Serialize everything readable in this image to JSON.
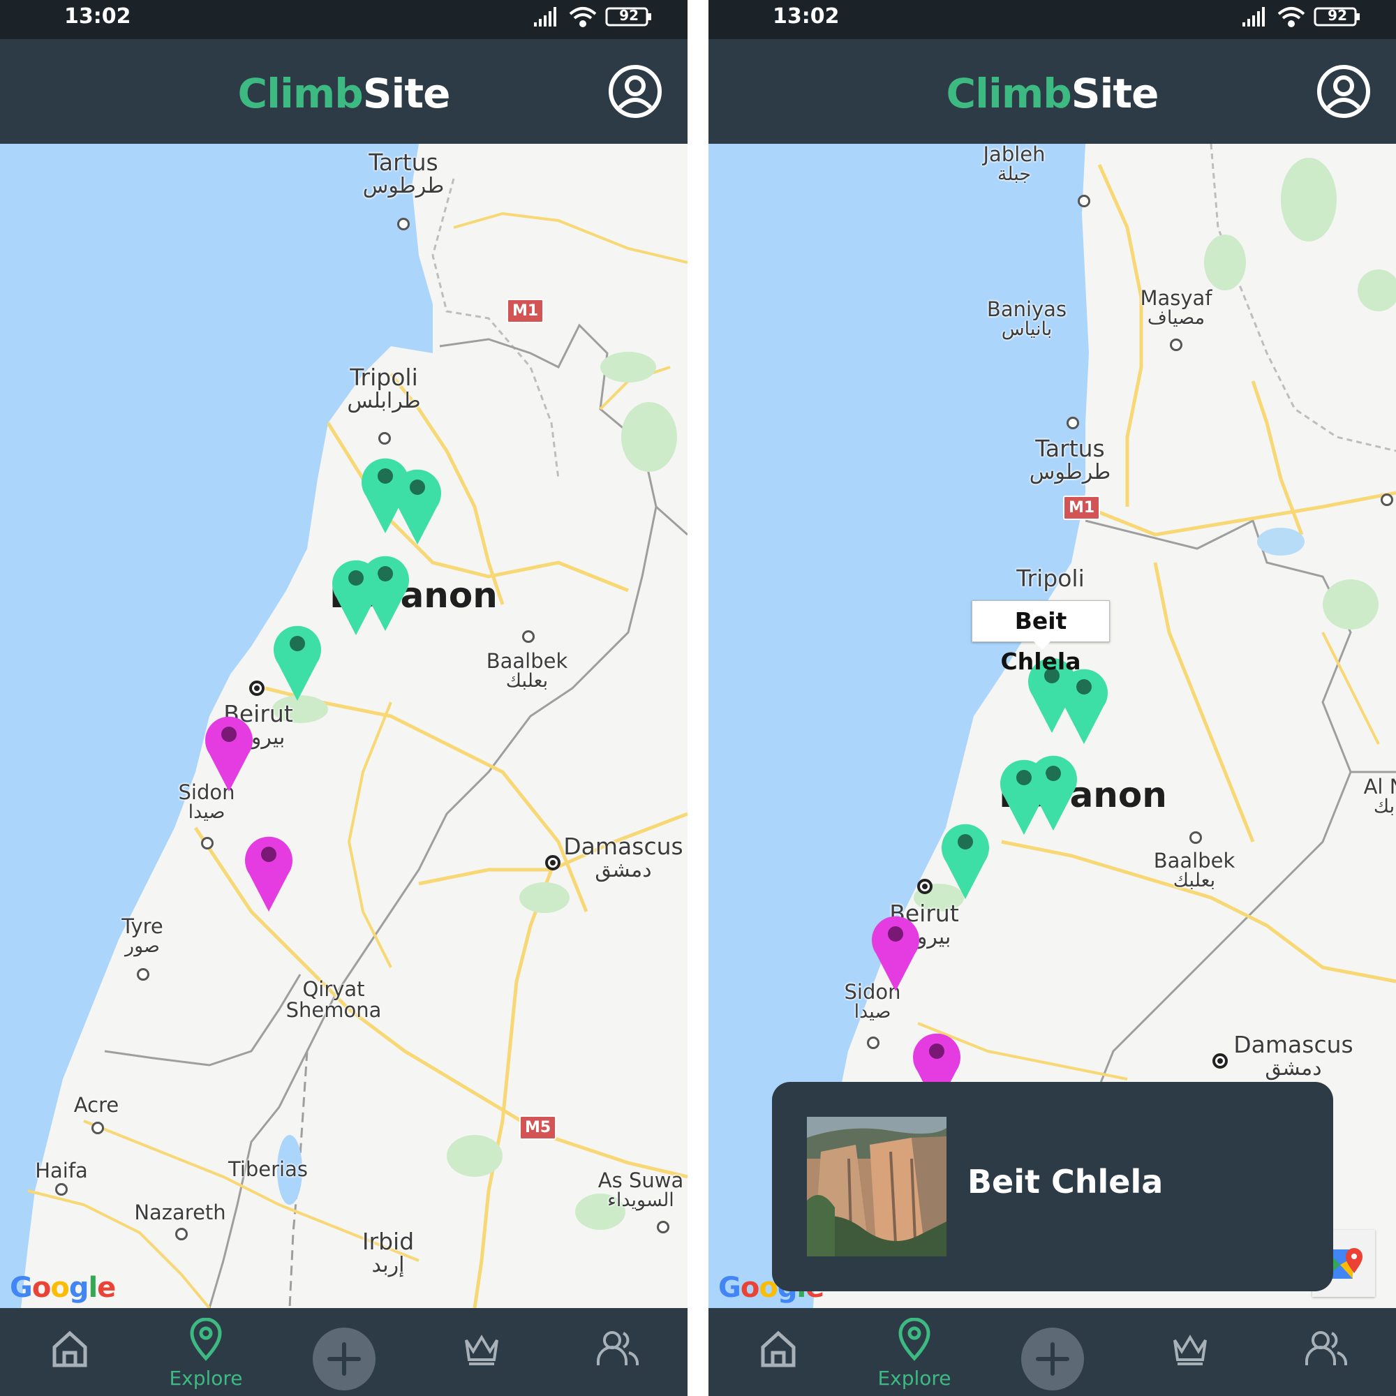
{
  "status_bar": {
    "time": "13:02",
    "battery": "92"
  },
  "app": {
    "title_part1": "Climb",
    "title_part2": "Site"
  },
  "map1": {
    "places": [
      {
        "en": "Tartus",
        "ar": "طرطوس"
      },
      {
        "en": "Tripoli",
        "ar": "طرابلس"
      },
      {
        "en": "Baalbek",
        "ar": "بعلبك"
      },
      {
        "en": "Beirut",
        "ar": "بيروت"
      },
      {
        "en": "Sidon",
        "ar": "صيدا"
      },
      {
        "en": "Damascus",
        "ar": "دمشق"
      },
      {
        "en": "Tyre",
        "ar": "صور"
      },
      {
        "en": "Qiryat",
        "ar": "Shemona"
      },
      {
        "en": "Acre",
        "ar": ""
      },
      {
        "en": "Haifa",
        "ar": ""
      },
      {
        "en": "Tiberias",
        "ar": ""
      },
      {
        "en": "Nazareth",
        "ar": ""
      },
      {
        "en": "Irbid",
        "ar": "إربد"
      },
      {
        "en": "As Suwa",
        "ar": "السويداء"
      }
    ],
    "country": "Lebanon",
    "shields": [
      "M1",
      "M5"
    ]
  },
  "map2": {
    "places": [
      {
        "en": "Jableh",
        "ar": "جبلة"
      },
      {
        "en": "Baniyas",
        "ar": "بانياس"
      },
      {
        "en": "Masyaf",
        "ar": "مصياف"
      },
      {
        "en": "Tartus",
        "ar": "طرطوس"
      },
      {
        "en": "Tripoli",
        "ar": ""
      },
      {
        "en": "Baalbek",
        "ar": "بعلبك"
      },
      {
        "en": "Beirut",
        "ar": "بيروت"
      },
      {
        "en": "Sidon",
        "ar": "صيدا"
      },
      {
        "en": "Damascus",
        "ar": "دمشق"
      },
      {
        "en": "Al N",
        "ar": "بك"
      }
    ],
    "country": "Lebanon",
    "shields": [
      "M1"
    ]
  },
  "selected_site": {
    "tooltip": "Beit Chlela",
    "card_name": "Beit Chlela"
  },
  "colors": {
    "pin_green": "#3ddfa6",
    "pin_magenta": "#e43ce0",
    "accent": "#3dba82",
    "bar": "#2d3b47"
  },
  "nav": {
    "home": "home-icon",
    "explore_label": "Explore",
    "add": "plus-icon",
    "ranking": "crown-icon",
    "community": "users-icon"
  },
  "google": "Google"
}
